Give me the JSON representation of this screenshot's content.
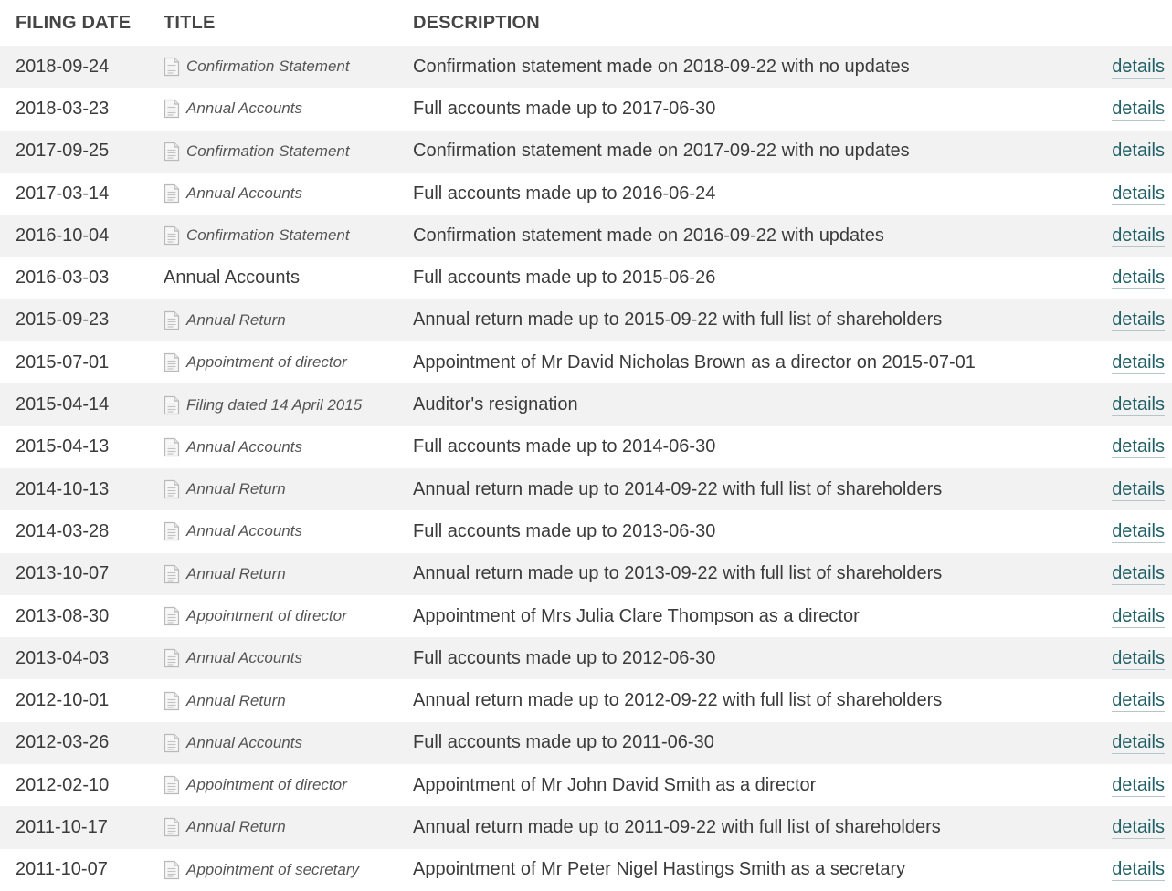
{
  "table": {
    "headers": {
      "date": "FILING DATE",
      "title": "TITLE",
      "description": "DESCRIPTION"
    },
    "link_label": "details",
    "rows": [
      {
        "date": "2018-09-24",
        "title": "Confirmation Statement",
        "description": "Confirmation statement made on 2018-09-22 with no updates",
        "link": "details"
      },
      {
        "date": "2018-03-23",
        "title": "Annual Accounts",
        "description": "Full accounts made up to 2017-06-30",
        "link": "details"
      },
      {
        "date": "2017-09-25",
        "title": "Confirmation Statement",
        "description": "Confirmation statement made on 2017-09-22 with no updates",
        "link": "details"
      },
      {
        "date": "2017-03-14",
        "title": "Annual Accounts",
        "description": "Full accounts made up to 2016-06-24",
        "link": "details"
      },
      {
        "date": "2016-10-04",
        "title": "Confirmation Statement",
        "description": "Confirmation statement made on 2016-09-22 with updates",
        "link": "details"
      },
      {
        "date": "2016-03-03",
        "title": "Annual Accounts",
        "description": "Full accounts made up to 2015-06-26",
        "link": "details",
        "plain": true
      },
      {
        "date": "2015-09-23",
        "title": "Annual Return",
        "description": "Annual return made up to 2015-09-22 with full list of shareholders",
        "link": "details"
      },
      {
        "date": "2015-07-01",
        "title": "Appointment of director",
        "description": "Appointment of Mr David Nicholas Brown as a director on 2015-07-01",
        "link": "details"
      },
      {
        "date": "2015-04-14",
        "title": "Filing dated 14 April 2015",
        "description": "Auditor's resignation",
        "link": "details"
      },
      {
        "date": "2015-04-13",
        "title": "Annual Accounts",
        "description": "Full accounts made up to 2014-06-30",
        "link": "details"
      },
      {
        "date": "2014-10-13",
        "title": "Annual Return",
        "description": "Annual return made up to 2014-09-22 with full list of shareholders",
        "link": "details"
      },
      {
        "date": "2014-03-28",
        "title": "Annual Accounts",
        "description": "Full accounts made up to 2013-06-30",
        "link": "details"
      },
      {
        "date": "2013-10-07",
        "title": "Annual Return",
        "description": "Annual return made up to 2013-09-22 with full list of shareholders",
        "link": "details"
      },
      {
        "date": "2013-08-30",
        "title": "Appointment of director",
        "description": "Appointment of Mrs Julia Clare Thompson as a director",
        "link": "details"
      },
      {
        "date": "2013-04-03",
        "title": "Annual Accounts",
        "description": "Full accounts made up to 2012-06-30",
        "link": "details"
      },
      {
        "date": "2012-10-01",
        "title": "Annual Return",
        "description": "Annual return made up to 2012-09-22 with full list of shareholders",
        "link": "details"
      },
      {
        "date": "2012-03-26",
        "title": "Annual Accounts",
        "description": "Full accounts made up to 2011-06-30",
        "link": "details"
      },
      {
        "date": "2012-02-10",
        "title": "Appointment of director",
        "description": "Appointment of Mr John David Smith as a director",
        "link": "details"
      },
      {
        "date": "2011-10-17",
        "title": "Annual Return",
        "description": "Annual return made up to 2011-09-22 with full list of shareholders",
        "link": "details"
      },
      {
        "date": "2011-10-07",
        "title": "Appointment of secretary",
        "description": "Appointment of Mr Peter Nigel Hastings Smith as a secretary",
        "link": "details"
      }
    ]
  }
}
